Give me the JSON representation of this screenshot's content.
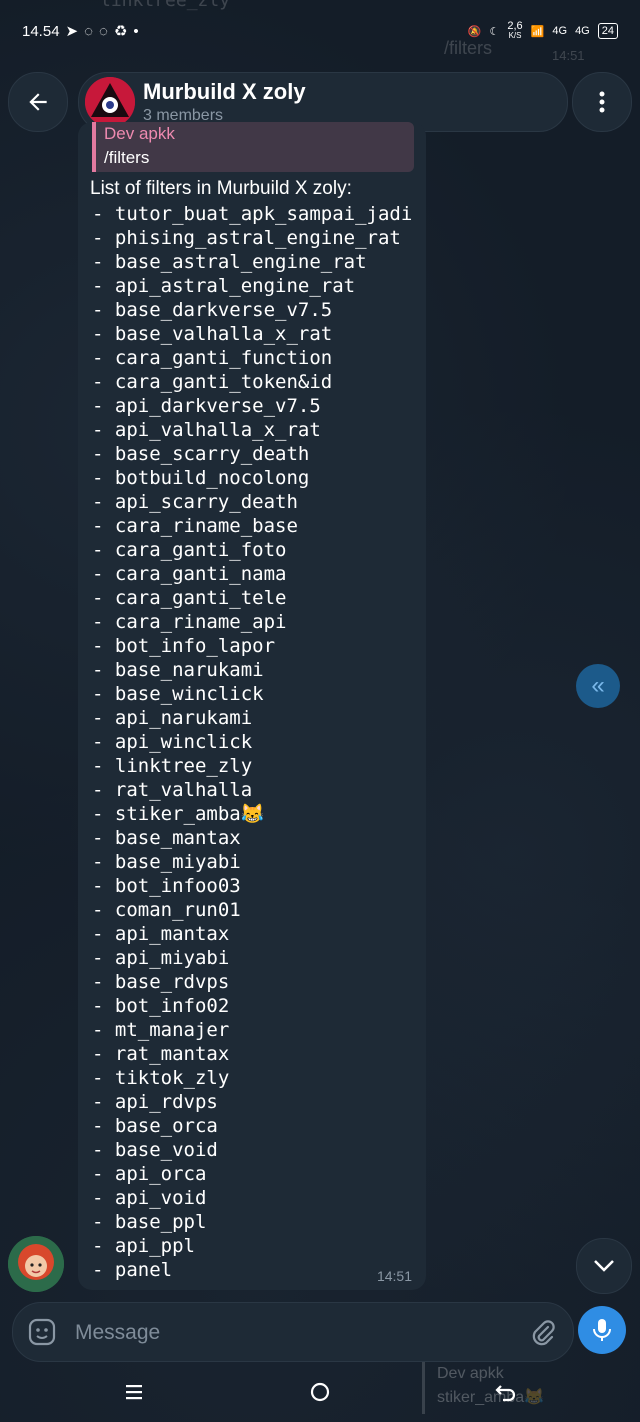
{
  "status_bar": {
    "time": "14.54",
    "net_speed": "2,6",
    "net_unit": "K/S",
    "signal_a": "4G",
    "signal_b": "4G",
    "battery": "24"
  },
  "background_ghost": {
    "top_left": "linktree_zly",
    "top_right": "/filters",
    "top_right_time": "14:51"
  },
  "header": {
    "title": "Murbuild X zoly",
    "subtitle": "3 members"
  },
  "message": {
    "reply_to_name": "Dev apkk",
    "reply_to_text": "/filters",
    "heading": "List of filters in Murbuild X zoly:",
    "time": "14:51",
    "filters": [
      "- tutor_buat_apk_sampai_jadi",
      "- phising_astral_engine_rat",
      "- base_astral_engine_rat",
      "- api_astral_engine_rat",
      "- base_darkverse_v7.5",
      "- base_valhalla_x_rat",
      "- cara_ganti_function",
      "- cara_ganti_token&id",
      "- api_darkverse_v7.5",
      "- api_valhalla_x_rat",
      "- base_scarry_death",
      "- botbuild_nocolong",
      "- api_scarry_death",
      "- cara_riname_base",
      "- cara_ganti_foto",
      "- cara_ganti_nama",
      "- cara_ganti_tele",
      "- cara_riname_api",
      "- bot_info_lapor",
      "- base_narukami",
      "- base_winclick",
      "- api_narukami",
      "- api_winclick",
      "- linktree_zly",
      "- rat_valhalla",
      "- stiker_amba😹",
      "- base_mantax",
      "- base_miyabi",
      "- bot_infoo03",
      "- coman_run01",
      "- api_mantax",
      "- api_miyabi",
      "- base_rdvps",
      "- bot_info02",
      "- mt_manajer",
      "- rat_mantax",
      "- tiktok_zly",
      "- api_rdvps",
      "- base_orca",
      "- base_void",
      "- api_orca",
      "- api_void",
      "- base_ppl",
      "- api_ppl",
      "- panel"
    ]
  },
  "input": {
    "placeholder": "Message"
  },
  "ghost_reply": {
    "name": "Dev apkk",
    "text": "stiker_amba😹"
  },
  "icons": {
    "back": "arrow-left-icon",
    "menu": "kebab-menu-icon",
    "emoji": "sticker-icon",
    "attach": "paperclip-icon",
    "mic": "microphone-icon",
    "jump": "double-chevron-left-icon",
    "scroll_down": "chevron-down-icon"
  },
  "colors": {
    "accent": "#2f8de4",
    "reply_accent": "#e27aa0",
    "bubble": "#1e2a36"
  }
}
